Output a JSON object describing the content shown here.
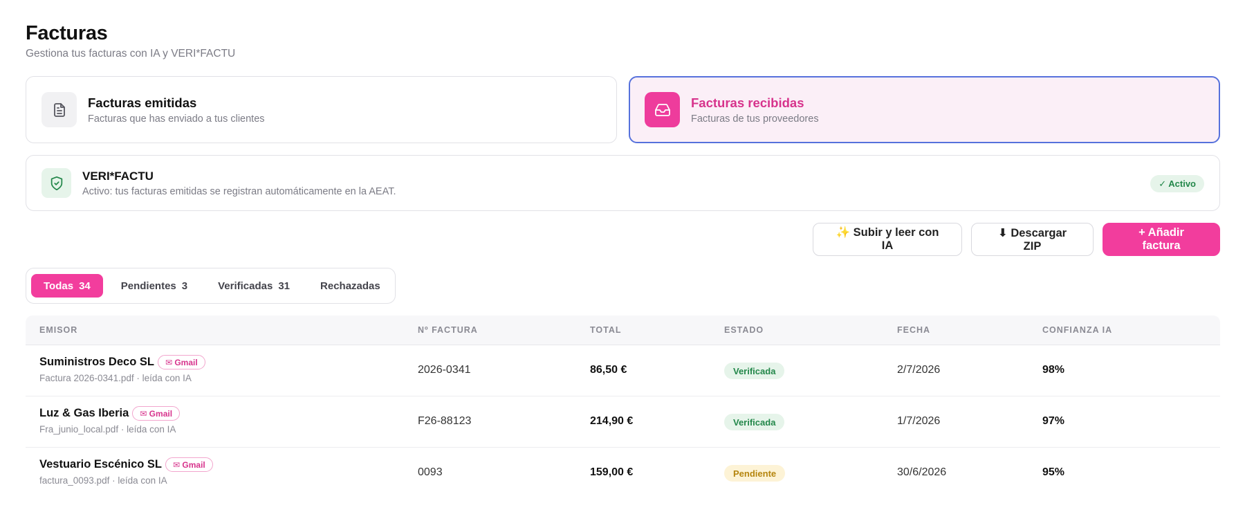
{
  "page": {
    "title": "Facturas",
    "subtitle": "Gestiona tus facturas con IA y VERI*FACTU"
  },
  "cards": {
    "emitidas": {
      "title": "Facturas emitidas",
      "desc": "Facturas que has enviado a tus clientes",
      "icon": "document-icon"
    },
    "recibidas": {
      "title": "Facturas recibidas",
      "desc": "Facturas de tus proveedores",
      "icon": "inbox-icon"
    }
  },
  "verifactu": {
    "title": "VERI*FACTU",
    "desc": "Activo: tus facturas emitidas se registran automáticamente en la AEAT.",
    "badge": "✓ Activo",
    "icon": "shield-check-icon"
  },
  "actions": {
    "upload": "✨ Subir y leer con IA",
    "download": "⬇ Descargar ZIP",
    "add": "+ Añadir factura"
  },
  "filters": [
    {
      "label": "Todas",
      "count": "34"
    },
    {
      "label": "Pendientes",
      "count": "3"
    },
    {
      "label": "Verificadas",
      "count": "31"
    },
    {
      "label": "Rechazadas",
      "count": ""
    }
  ],
  "table": {
    "headers": [
      "EMISOR",
      "Nº FACTURA",
      "TOTAL",
      "ESTADO",
      "FECHA",
      "CONFIANZA IA"
    ],
    "rows": [
      {
        "emisor": "Suministros Deco SL",
        "source": "✉ Gmail",
        "file": "Factura 2026-0341.pdf · leída con IA",
        "numero": "2026-0341",
        "total": "86,50 €",
        "estado": "Verificada",
        "fecha": "2/7/2026",
        "confianza": "98%"
      },
      {
        "emisor": "Luz & Gas Iberia",
        "source": "✉ Gmail",
        "file": "Fra_junio_local.pdf · leída con IA",
        "numero": "F26-88123",
        "total": "214,90 €",
        "estado": "Verificada",
        "fecha": "1/7/2026",
        "confianza": "97%"
      },
      {
        "emisor": "Vestuario Escénico SL",
        "source": "✉ Gmail",
        "file": "factura_0093.pdf · leída con IA",
        "numero": "0093",
        "total": "159,00 €",
        "estado": "Pendiente",
        "fecha": "30/6/2026",
        "confianza": "95%"
      }
    ]
  },
  "colors": {
    "accent": "#f23d9d",
    "selected_border": "#5671dc",
    "success": "#23874a",
    "warning": "#b5850e"
  }
}
